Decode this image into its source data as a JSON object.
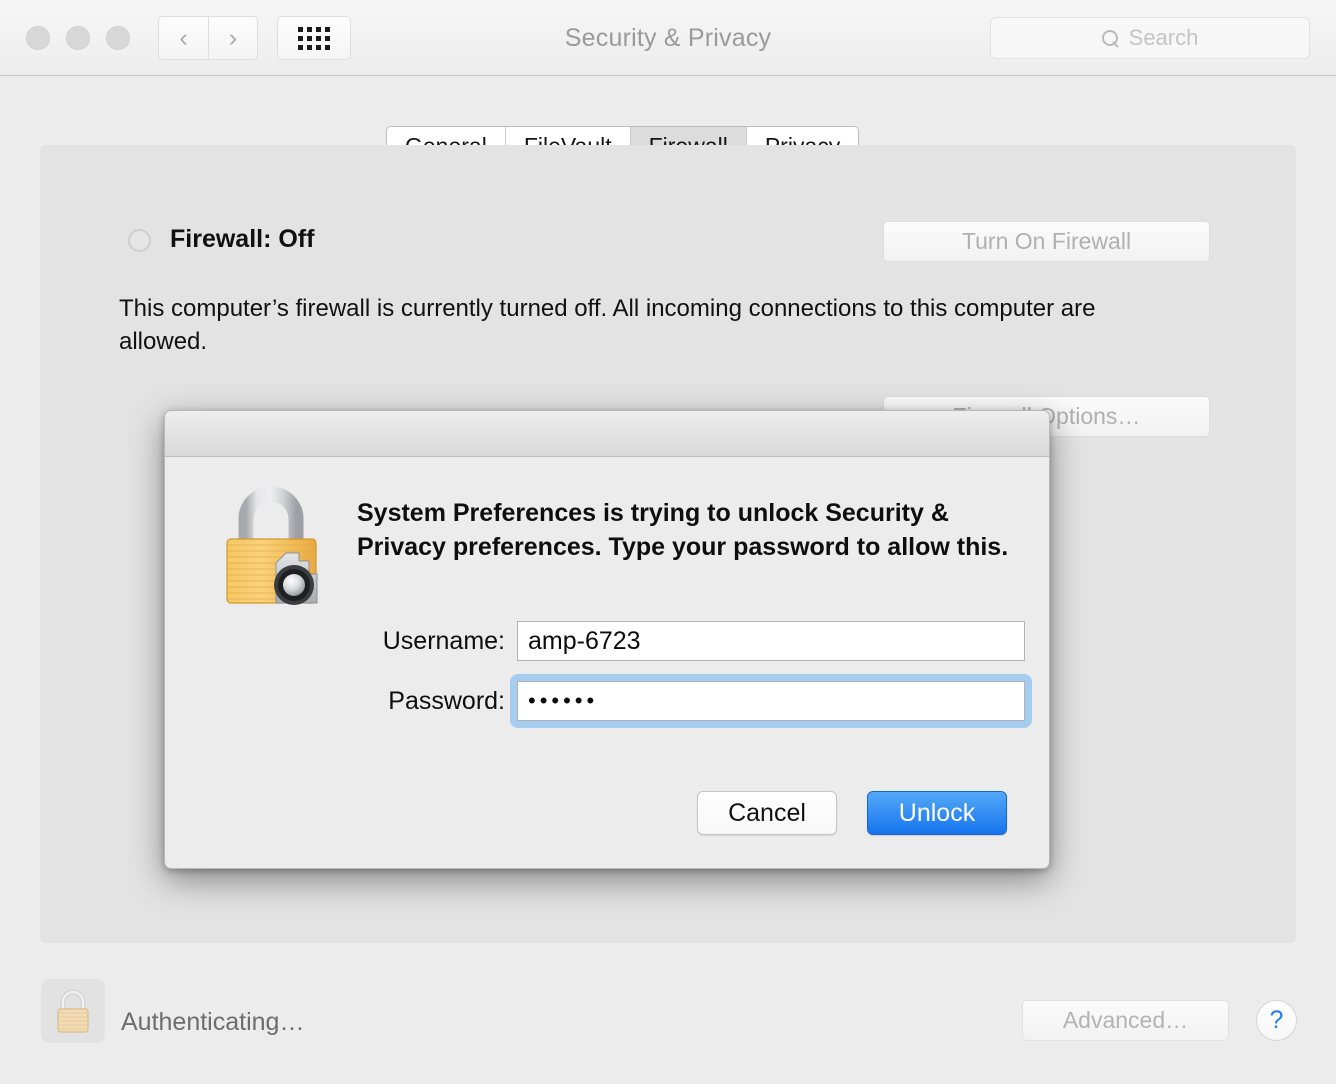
{
  "window": {
    "title": "Security & Privacy"
  },
  "toolbar": {
    "back_icon": "chevron-left-icon",
    "forward_icon": "chevron-right-icon",
    "grid_icon": "show-all-grid-icon",
    "search": {
      "icon": "search-icon",
      "placeholder": "Search",
      "value": ""
    }
  },
  "tabs": [
    {
      "label": "General",
      "selected": false
    },
    {
      "label": "FileVault",
      "selected": false
    },
    {
      "label": "Firewall",
      "selected": true
    },
    {
      "label": "Privacy",
      "selected": false
    }
  ],
  "firewall_pane": {
    "status_label": "Firewall: Off",
    "status_indicator": "off",
    "turn_on_button": "Turn On Firewall",
    "description": "This computer’s firewall is currently turned off. All incoming connections to this computer are allowed.",
    "options_button": "Firewall Options…"
  },
  "bottom_bar": {
    "lock_icon": "padlock-closed-icon",
    "auth_status": "Authenticating…",
    "advanced_button": "Advanced…",
    "help_button": "?"
  },
  "auth_dialog": {
    "icon": "padlock-vault-icon",
    "message": "System Preferences is trying to unlock Security & Privacy preferences. Type your password to allow this.",
    "username": {
      "label": "Username:",
      "value": "amp-6723"
    },
    "password": {
      "label": "Password:",
      "value": "••••••",
      "focused": true
    },
    "cancel_button": "Cancel",
    "unlock_button": "Unlock"
  },
  "colors": {
    "accent_blue": "#1574ee",
    "focus_ring": "#a5cdf0",
    "help_blue": "#1f7ef4",
    "window_bg": "#ececec",
    "panel_bg": "#e3e3e3",
    "lock_gold": "#f0b košt"
  }
}
